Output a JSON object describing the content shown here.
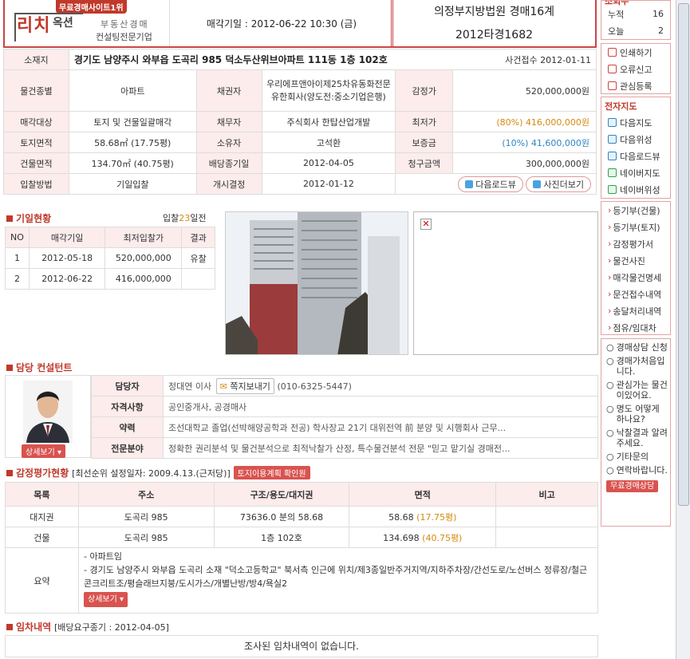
{
  "header": {
    "logo_badge": "무료경매사이트1위",
    "logo_main": "리치",
    "logo_okseon": "옥션",
    "logo_sub1": "부동산경매",
    "logo_sub2": "컨설팅전문기업",
    "sale_date": "매각기일 : 2012-06-22 10:30 (금)",
    "court": "의정부지방법원 경매16계",
    "case_no": "2012타경1682"
  },
  "info": {
    "address_label": "소재지",
    "address": "경기도 남양주시 와부읍 도곡리 985 덕소두산위브아파트 111동 1층 102호",
    "case_received": "사건접수 2012-01-11",
    "rows": [
      {
        "l1": "물건종별",
        "v1": "아파트",
        "l2": "채권자",
        "v2": "우리에프앤아이제25차유동화전문 유한회사(양도전:중소기업은행)",
        "l3": "감정가",
        "v3": "520,000,000원"
      },
      {
        "l1": "매각대상",
        "v1": "토지 및 건물일괄매각",
        "l2": "채무자",
        "v2": "주식회사 한탑산업개발",
        "l3": "최저가",
        "v3": "(80%) 416,000,000원"
      },
      {
        "l1": "토지면적",
        "v1": "58.68㎡ (17.75평)",
        "l2": "소유자",
        "v2": "고석환",
        "l3": "보증금",
        "v3": "(10%) 41,600,000원"
      },
      {
        "l1": "건물면적",
        "v1": "134.70㎡ (40.75평)",
        "l2": "배당종기일",
        "v2": "2012-04-05",
        "l3": "청구금액",
        "v3": "300,000,000원"
      },
      {
        "l1": "입찰방법",
        "v1": "기일입찰",
        "l2": "개시결정",
        "v2": "2012-01-12"
      }
    ],
    "btn_roadview": "다음로드뷰",
    "btn_photos": "사진더보기"
  },
  "bid": {
    "title": "기일현황",
    "days_prefix": "입찰",
    "days_num": "23",
    "days_suffix": "일전",
    "headers": [
      "NO",
      "매각기일",
      "최저입찰가",
      "결과"
    ],
    "rows": [
      [
        "1",
        "2012-05-18",
        "520,000,000",
        "유찰"
      ],
      [
        "2",
        "2012-06-22",
        "416,000,000",
        ""
      ]
    ]
  },
  "consultant": {
    "title": "담당 컨설턴트",
    "detail_btn": "상세보기",
    "rows": [
      {
        "label": "담당자",
        "value": "정대연 이사",
        "msg_btn": "쪽지보내기",
        "phone": "(010-6325-5447)"
      },
      {
        "label": "자격사항",
        "value": "공인중개사, 공경매사"
      },
      {
        "label": "약력",
        "value": "조선대학교 졸업(선박해양공학과 전공) 학사장교 21기 대위전역 前 분양 및 시행회사 근무..."
      },
      {
        "label": "전문분야",
        "value": "정확한 권리분석 및 물건분석으로 최적낙찰가 산정, 특수물건분석 전문 \"믿고 맡기실 경매전..."
      }
    ]
  },
  "appraisal": {
    "title": "감정평가현황",
    "note": "[최선순위 설정일자: 2009.4.13.(근저당)]",
    "land_btn": "토지이용계획 확인원",
    "headers": [
      "목록",
      "주소",
      "구조/용도/대지권",
      "면적",
      "비고"
    ],
    "rows": [
      {
        "c1": "대지권",
        "c2": "도곡리 985",
        "c3": "73636.0 분의 58.68",
        "c4a": "58.68 ",
        "c4b": "(17.75평)",
        "c5": ""
      },
      {
        "c1": "건물",
        "c2": "도곡리 985",
        "c3": "1층 102호",
        "c4a": "134.698 ",
        "c4b": "(40.75평)",
        "c5": ""
      }
    ],
    "summary_label": "요약",
    "summary_lines": [
      "- 아파트임",
      "- 경기도 남양주시 와부읍 도곡리 소재 \"덕소고등학교\" 북서측 인근에 위치/제3종일반주거지역/지하주차장/간선도로/노선버스 정류장/철근콘크리트조/평슬래브지붕/도시가스/개별난방/방4/욕실2"
    ],
    "detail_btn": "상세보기"
  },
  "lease": {
    "title": "임차내역",
    "note": "[배당요구종기 : 2012-04-05]",
    "empty": "조사된 임차내역이 없습니다."
  },
  "side": {
    "top_title": "조회수",
    "stats": [
      {
        "k": "누적",
        "v": "16"
      },
      {
        "k": "오늘",
        "v": "2"
      }
    ],
    "actions": [
      "인쇄하기",
      "오류신고",
      "관심등록"
    ],
    "map_title": "전자지도",
    "maps": [
      "다음지도",
      "다음위성",
      "다음로드뷰",
      "네이버지도",
      "네이버위성"
    ],
    "docs": [
      "등기부(건물)",
      "등기부(토지)",
      "감정평가서",
      "물건사진",
      "매각물건명세",
      "문건접수내역",
      "송달처리내역",
      "점유/임대차"
    ],
    "consult": [
      "경매상담 신청",
      "경매가처음입니다.",
      "관심가는 물건이있어요.",
      "명도 어떻게 하나요?",
      "낙찰결과 알려주세요.",
      "기타문의",
      "연락바랍니다."
    ],
    "consult_btn": "무료경매상담"
  }
}
